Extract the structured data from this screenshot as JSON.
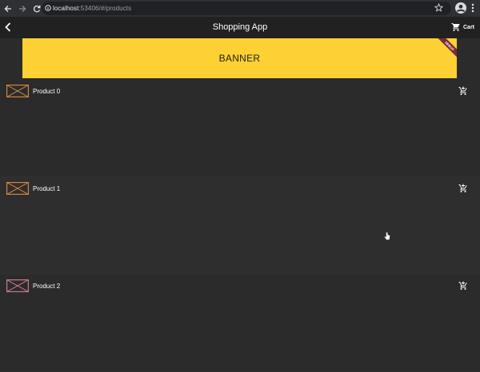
{
  "browser": {
    "url_host": "localhost",
    "url_path": ":53406/#/products"
  },
  "app_bar": {
    "title": "Shopping App",
    "cart_label": "Cart"
  },
  "banner": {
    "text": "BANNER",
    "ribbon_text": "DEBUG",
    "color": "#fdd033"
  },
  "products": [
    {
      "name": "Product 0"
    },
    {
      "name": "Product 1"
    },
    {
      "name": "Product 2"
    }
  ],
  "icons": {
    "back": "arrow-left-icon",
    "cart": "shopping-cart-icon",
    "add_to_cart": "add-shopping-cart-icon",
    "thumb": "image-placeholder-icon"
  },
  "colors": {
    "background": "#2b2b2b",
    "app_bar": "#212121",
    "thumb_border": "#d2843b",
    "thumb_border_alt": "#c97a8a"
  }
}
